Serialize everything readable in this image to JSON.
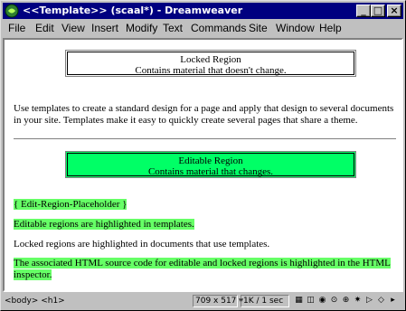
{
  "window": {
    "title": "<<Template>> (scaal*) - Dreamweaver",
    "minimize": "_",
    "maximize": "□",
    "close": "×"
  },
  "menu": [
    "File",
    "Edit",
    "View",
    "Insert",
    "Modify",
    "Text",
    "Commands",
    "Site",
    "Window",
    "Help"
  ],
  "locked_region": {
    "title": "Locked Region",
    "desc": "Contains material that doesn't change."
  },
  "intro": "Use templates to create a standard design for a page and apply that design to several documents in your site. Templates make it easy to quickly create several pages that share a theme.",
  "editable_region": {
    "title": "Editable Region",
    "desc": "Contains material that changes."
  },
  "placeholder": "{ Edit-Region-Placeholder }",
  "para1": "Editable regions are highlighted in templates.",
  "para2": "Locked regions are highlighted in documents that use templates.",
  "para3": "The associated HTML source code for editable and locked regions is highlighted in the HTML inspector.",
  "status": {
    "tags": "<body> <h1>",
    "size": "709 x 517",
    "speed": "1K / 1 sec"
  },
  "colors": {
    "titlebar": "#000080",
    "editable": "#00ff66",
    "highlight": "#66ff66"
  }
}
